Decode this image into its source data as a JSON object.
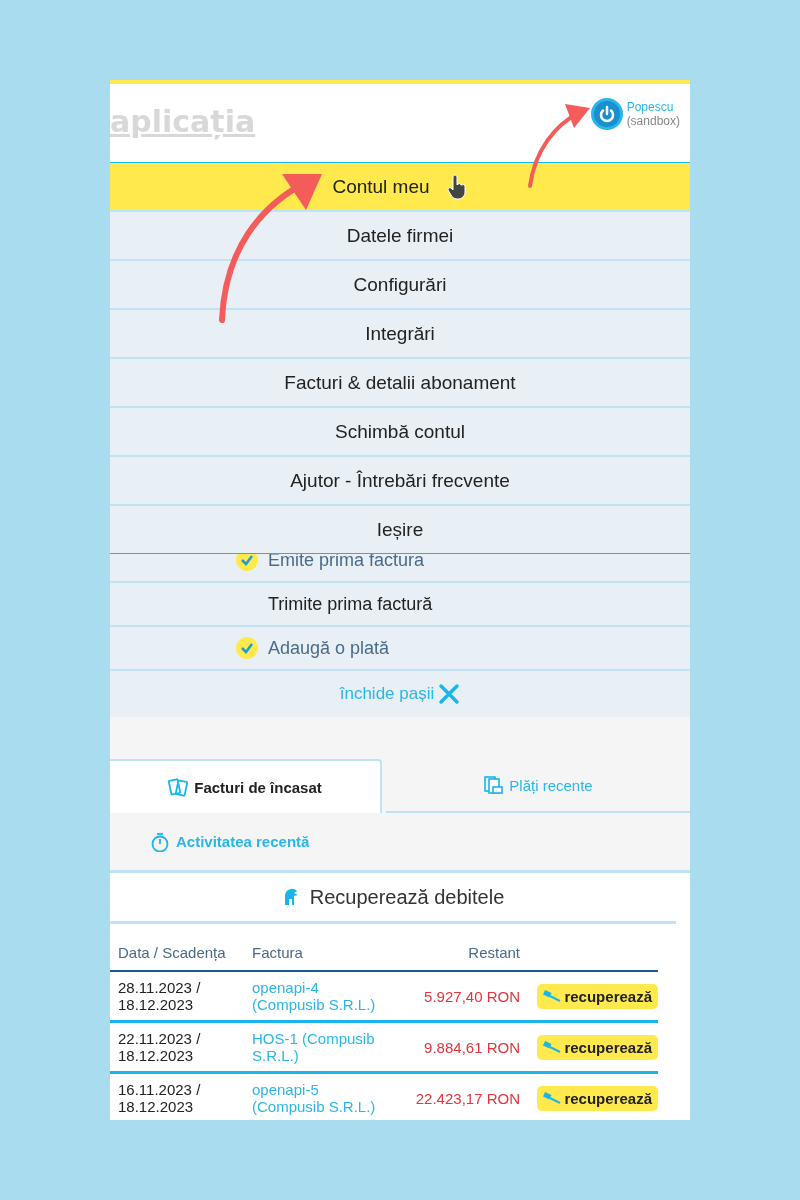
{
  "header": {
    "logo": "aplicația",
    "user": "Popescu",
    "account": "(sandbox)"
  },
  "menu": [
    {
      "label": "Contul meu",
      "selected": true
    },
    {
      "label": "Datele firmei",
      "selected": false
    },
    {
      "label": "Configurări",
      "selected": false
    },
    {
      "label": "Integrări",
      "selected": false
    },
    {
      "label": "Facturi & detalii abonament",
      "selected": false
    },
    {
      "label": "Schimbă contul",
      "selected": false
    },
    {
      "label": "Ajutor - Întrebări frecvente",
      "selected": false
    },
    {
      "label": "Ieșire",
      "selected": false
    }
  ],
  "steps": [
    {
      "label": "Emite prima factura",
      "checked": true
    },
    {
      "label": "Trimite prima factură",
      "checked": false
    },
    {
      "label": "Adaugă o plată",
      "checked": true
    }
  ],
  "close_steps": "închide pașii",
  "tabs": [
    {
      "label": "Facturi de încasat",
      "selected": true,
      "kind": "cards"
    },
    {
      "label": "Plăți recente",
      "selected": false,
      "kind": "receipts"
    },
    {
      "label": "Activitatea recentă",
      "selected": false,
      "kind": "stopwatch"
    }
  ],
  "debts": {
    "title": "Recuperează debitele",
    "columns": [
      "Data / Scadența",
      "Factura",
      "Restant"
    ],
    "rows": [
      {
        "date": "28.11.2023 / 18.12.2023",
        "invoice": "openapi-4 (Compusib S.R.L.)",
        "amount": "5.927,40 RON",
        "action": "recuperează"
      },
      {
        "date": "22.11.2023 / 18.12.2023",
        "invoice": "HOS-1 (Compusib S.R.L.)",
        "amount": "9.884,61 RON",
        "action": "recuperează"
      },
      {
        "date": "16.11.2023 / 18.12.2023",
        "invoice": "openapi-5 (Compusib S.R.L.)",
        "amount": "22.423,17 RON",
        "action": "recuperează"
      }
    ]
  }
}
